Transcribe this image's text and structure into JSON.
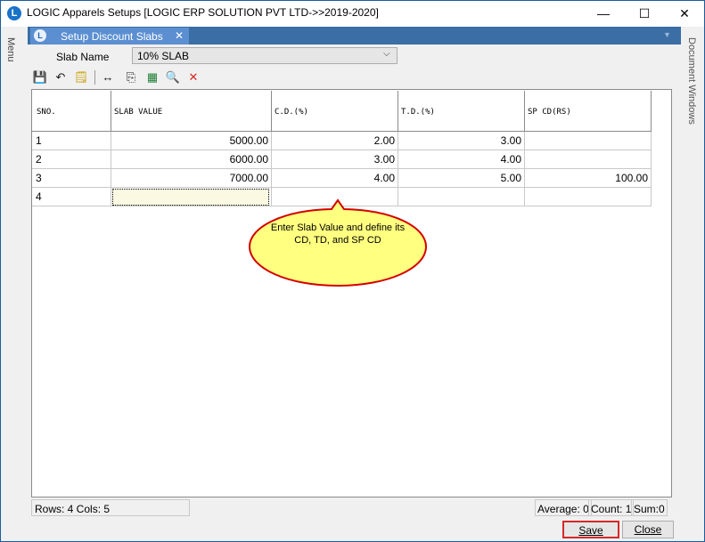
{
  "window": {
    "title": "LOGIC Apparels Setups  [LOGIC ERP SOLUTION PVT LTD->>2019-2020]",
    "app_icon": "L",
    "minimize_glyph": "—",
    "maximize_glyph": "☐",
    "close_glyph": "✕"
  },
  "side_panels": {
    "menu_label": "Menu",
    "document_windows_label": "Document Windows"
  },
  "tab": {
    "label": "Setup Discount Slabs",
    "icon": "L",
    "close_glyph": "✕",
    "overflow_glyph": "▼"
  },
  "form": {
    "slab_name_label": "Slab Name",
    "slab_name_value": "10% SLAB",
    "dropdown_glyph": "⌵"
  },
  "toolbar": [
    {
      "name": "save-icon",
      "glyph": "💾",
      "color": "#1a1a1a"
    },
    {
      "name": "undo-icon",
      "glyph": "↶",
      "color": "#1a1a1a"
    },
    {
      "name": "notes-icon",
      "glyph": "🗒",
      "color": "#c8a000"
    },
    {
      "name": "column-width-icon",
      "glyph": "↔",
      "color": "#1a1a1a"
    },
    {
      "name": "copy-icon",
      "glyph": "⎘",
      "color": "#1a1a1a"
    },
    {
      "name": "excel-icon",
      "glyph": "▦",
      "color": "#1e7e34"
    },
    {
      "name": "find-icon",
      "glyph": "🔍",
      "color": "#1a1a1a"
    },
    {
      "name": "delete-icon",
      "glyph": "✕",
      "color": "#d62828"
    }
  ],
  "grid": {
    "columns": [
      "SNO.",
      "SLAB VALUE",
      "C.D.(%)",
      "T.D.(%)",
      "SP CD(RS)"
    ],
    "rows": [
      [
        "1",
        "5000.00",
        "2.00",
        "3.00",
        ""
      ],
      [
        "2",
        "6000.00",
        "3.00",
        "4.00",
        ""
      ],
      [
        "3",
        "7000.00",
        "4.00",
        "5.00",
        "100.00"
      ],
      [
        "4",
        "",
        "",
        "",
        ""
      ]
    ]
  },
  "callout": {
    "text": "Enter Slab Value and define its CD, TD, and SP CD",
    "fill": "#ffff80",
    "border": "#d40000"
  },
  "status": {
    "rows_cols": "Rows: 4  Cols: 5",
    "average": "Average: 0",
    "count": "Count: 1",
    "sum": "Sum:0"
  },
  "buttons": {
    "save_label": "Save",
    "close_label": "Close"
  }
}
